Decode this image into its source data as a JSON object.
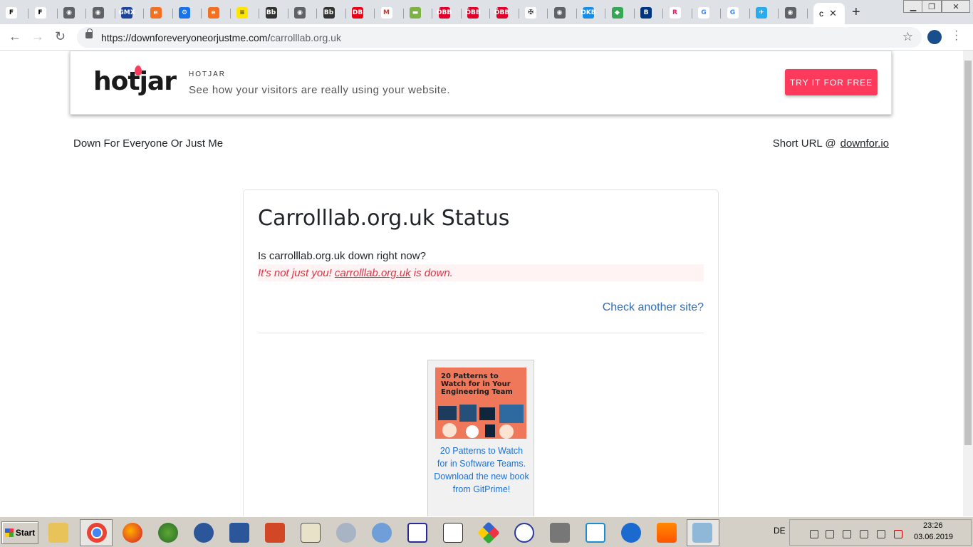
{
  "browser": {
    "tabs": [
      {
        "glyph": "F",
        "bg": "#ffffff",
        "fg": "#000000"
      },
      {
        "glyph": "F",
        "bg": "#ffffff",
        "fg": "#000000"
      },
      {
        "glyph": "◉",
        "bg": "#5f6368",
        "fg": "#ffffff"
      },
      {
        "glyph": "◉",
        "bg": "#5f6368",
        "fg": "#ffffff"
      },
      {
        "glyph": "GMX",
        "bg": "#1c449b",
        "fg": "#ffffff"
      },
      {
        "glyph": "e",
        "bg": "#f36f21",
        "fg": "#ffffff"
      },
      {
        "glyph": "⚙",
        "bg": "#1a73e8",
        "fg": "#ffffff"
      },
      {
        "glyph": "e",
        "bg": "#f36f21",
        "fg": "#ffffff"
      },
      {
        "glyph": "≡",
        "bg": "#ffe600",
        "fg": "#333333"
      },
      {
        "glyph": "Bb",
        "bg": "#333333",
        "fg": "#ffffff"
      },
      {
        "glyph": "◉",
        "bg": "#5f6368",
        "fg": "#ffffff"
      },
      {
        "glyph": "Bb",
        "bg": "#333333",
        "fg": "#ffffff"
      },
      {
        "glyph": "DB",
        "bg": "#ec0016",
        "fg": "#ffffff"
      },
      {
        "glyph": "M",
        "bg": "#ffffff",
        "fg": "#d93025"
      },
      {
        "glyph": "▬",
        "bg": "#7cb342",
        "fg": "#ffffff"
      },
      {
        "glyph": "ÖBB",
        "bg": "#e2002a",
        "fg": "#ffffff"
      },
      {
        "glyph": "ÖBB",
        "bg": "#e2002a",
        "fg": "#ffffff"
      },
      {
        "glyph": "ÖBB",
        "bg": "#e2002a",
        "fg": "#ffffff"
      },
      {
        "glyph": "✠",
        "bg": "#ffffff",
        "fg": "#000000"
      },
      {
        "glyph": "◉",
        "bg": "#5f6368",
        "fg": "#ffffff"
      },
      {
        "glyph": "DKB",
        "bg": "#148dea",
        "fg": "#ffffff"
      },
      {
        "glyph": "◆",
        "bg": "#34a853",
        "fg": "#ffffff"
      },
      {
        "glyph": "B",
        "bg": "#003580",
        "fg": "#ffffff"
      },
      {
        "glyph": "R",
        "bg": "#ffffff",
        "fg": "#e91e63"
      },
      {
        "glyph": "G",
        "bg": "#ffffff",
        "fg": "#4285f4"
      },
      {
        "glyph": "G",
        "bg": "#ffffff",
        "fg": "#4285f4"
      },
      {
        "glyph": "✈",
        "bg": "#2aabee",
        "fg": "#ffffff"
      },
      {
        "glyph": "◉",
        "bg": "#5f6368",
        "fg": "#ffffff"
      }
    ],
    "active_tab_glyph": "c",
    "url_host": "https://downforeveryoneorjustme.com/",
    "url_path": "carrolllab.org.uk"
  },
  "ad": {
    "logo": "hotjar",
    "brand": "HOTJAR",
    "tagline": "See how your visitors are really using your website.",
    "cta": "TRY IT FOR FREE",
    "accent": "#fd3a5c"
  },
  "header": {
    "site_name": "Down For Everyone Or Just Me",
    "short_url_label": "Short URL @",
    "short_url_link": "downfor.io"
  },
  "status": {
    "title": "Carrolllab.org.uk Status",
    "question": "Is carrolllab.org.uk down right now?",
    "verdict_prefix": "It's not just you! ",
    "verdict_domain": "carrolllab.org.uk",
    "verdict_suffix": " is down.",
    "check_another": "Check another site?"
  },
  "promo": {
    "image_title": "20 Patterns to Watch for in Your Engineering Team",
    "text": "20 Patterns to Watch for in Software Teams. Download the new book from GitPrime!"
  },
  "taskbar": {
    "start_label": "Start",
    "language": "DE",
    "time": "23:26",
    "date": "03.06.2019"
  }
}
